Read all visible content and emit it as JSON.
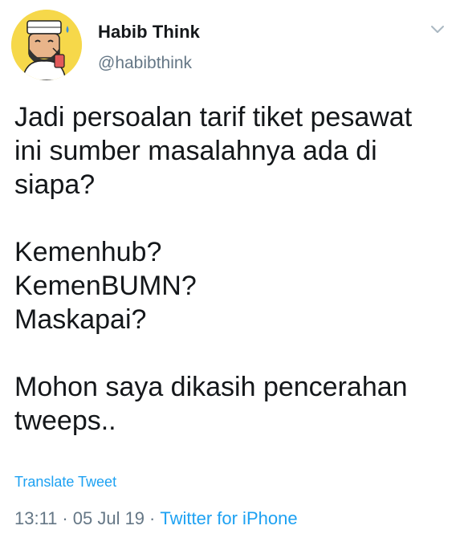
{
  "tweet": {
    "author": {
      "name": "Habib Think",
      "handle": "@habibthink"
    },
    "body": {
      "line1": "Jadi persoalan tarif tiket pesawat",
      "line2": "ini sumber masalahnya ada di",
      "line3": "siapa?",
      "line4": "Kemenhub?",
      "line5": "KemenBUMN?",
      "line6": "Maskapai?",
      "line7": "Mohon saya dikasih pencerahan",
      "line8": "tweeps.."
    },
    "translate_label": "Translate Tweet",
    "meta": {
      "time": "13:11",
      "separator": "·",
      "date": "05 Jul 19",
      "source": "Twitter for iPhone"
    }
  },
  "colors": {
    "accent": "#1da1f2",
    "secondary_text": "#657786",
    "primary_text": "#14171a",
    "avatar_bg": "#f6d84a"
  },
  "icons": {
    "avatar": "cartoon-avatar",
    "menu": "chevron-down-icon"
  }
}
